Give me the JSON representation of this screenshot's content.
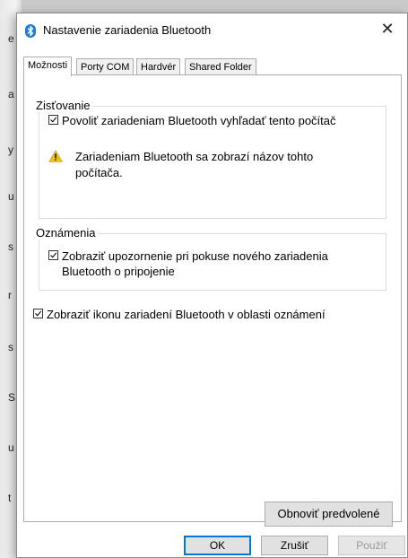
{
  "background_letters": [
    "e",
    "a",
    "y",
    "u",
    "s",
    "r",
    "s",
    "S",
    "u",
    "t"
  ],
  "dialog": {
    "title": "Nastavenie zariadenia Bluetooth",
    "close_glyph": "✕",
    "icon": "bluetooth-icon"
  },
  "tabs": [
    {
      "label": "Možnosti",
      "active": true
    },
    {
      "label": "Porty COM",
      "active": false
    },
    {
      "label": "Hardvér",
      "active": false
    },
    {
      "label": "Shared Folder",
      "active": false
    }
  ],
  "discovery": {
    "legend": "Zisťovanie",
    "allow_checkbox": {
      "label": "Povoliť zariadeniam Bluetooth vyhľadať tento počítač",
      "checked": true
    },
    "warning_line1": "Zariadeniam Bluetooth sa zobrazí názov tohto",
    "warning_line2": "počítača."
  },
  "notifications": {
    "legend": "Oznámenia",
    "alert_checkbox": {
      "line1": "Zobraziť upozornenie pri pokuse nového zariadenia",
      "line2": "Bluetooth o pripojenie",
      "checked": true
    }
  },
  "tray_checkbox": {
    "label": "Zobraziť ikonu zariadení Bluetooth v oblasti oznámení",
    "checked": true
  },
  "buttons": {
    "restore_defaults": "Obnoviť predvolené",
    "ok": "OK",
    "cancel": "Zrušiť",
    "apply": "Použiť"
  },
  "colors": {
    "accent": "#0078d7",
    "bluetooth": "#1e7ad8",
    "warning": "#f2c10f"
  }
}
